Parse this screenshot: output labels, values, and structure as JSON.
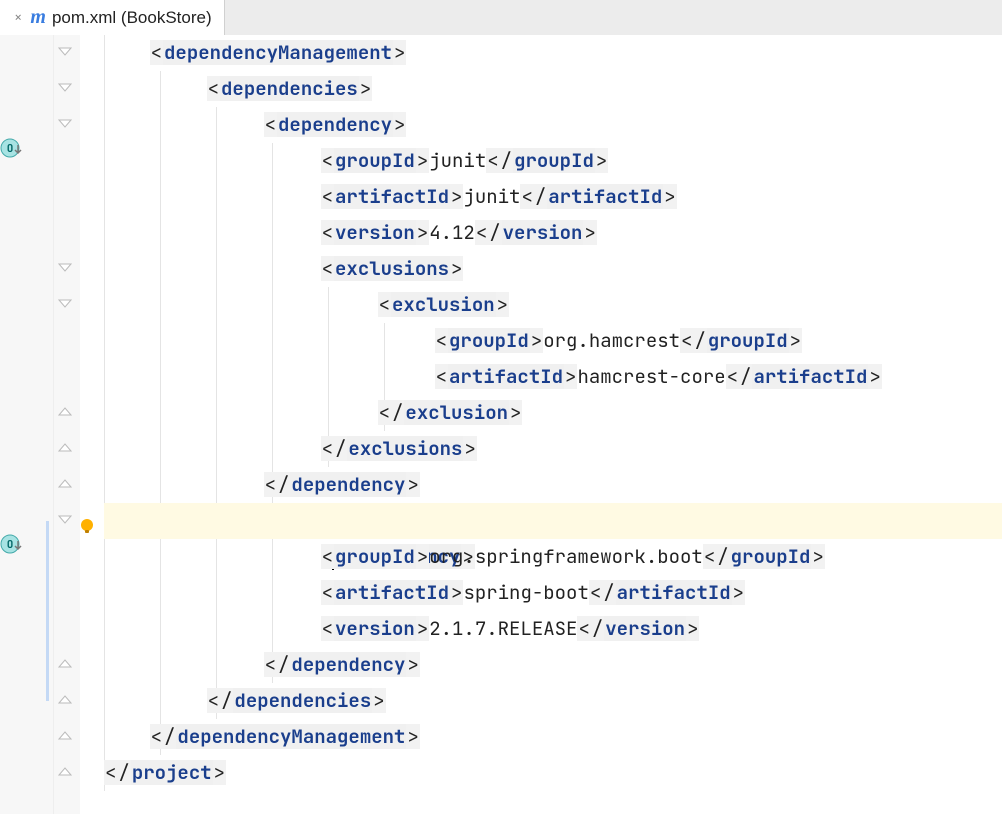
{
  "tab": {
    "label": "pom.xml (BookStore)"
  },
  "tokens": {
    "lt": "<",
    "gt": ">",
    "slash": "/",
    "dependencyManagement": "dependencyManagement",
    "dependencies": "dependencies",
    "dependency": "dependency",
    "groupId": "groupId",
    "artifactId": "artifactId",
    "version": "version",
    "exclusions": "exclusions",
    "exclusion": "exclusion",
    "project": "project"
  },
  "values": {
    "junit_group": "junit",
    "junit_artifact": "junit",
    "junit_version": "4.12",
    "hamcrest_group": "org.hamcrest",
    "hamcrest_artifact": "hamcrest-core",
    "spring_group": "org.springframework.boot",
    "spring_artifact": "spring-boot",
    "spring_version": "2.1.7.RELEASE"
  }
}
